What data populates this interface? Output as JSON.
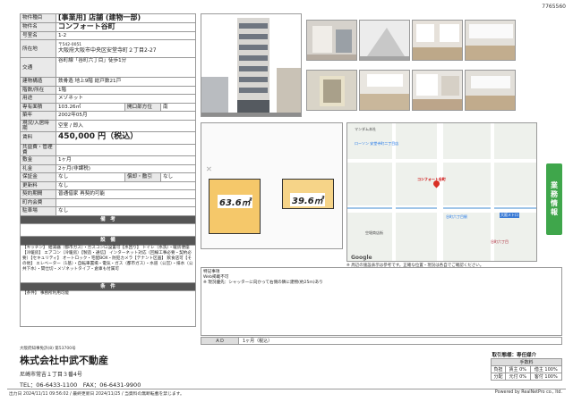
{
  "doc_id": "7765560",
  "property": {
    "type_label": "物件種目",
    "type_value": "[事業用] 店舗 (建物一部)",
    "name_label": "物件名",
    "name_value": "コンフォート谷町",
    "room_label": "号室名",
    "room_value": "1-2",
    "address_label": "所在地",
    "zip": "〒542-0051",
    "address": "大阪府大阪市中央区安堂寺町２丁目2-27",
    "access_label": "交通",
    "access_value": "谷町線「谷町六丁目」徒歩1分",
    "structure_label": "建物構造",
    "structure_value": "鉄骨造 地上9階 総戸数21戸",
    "floor_label": "階数/所在",
    "floor_value": "1階",
    "use_label": "用途",
    "use_value": "メゾネット",
    "area_label": "専有面積",
    "area_value": "103.26㎡",
    "direction_label": "開口部方位",
    "direction_value": "南",
    "built_label": "築年",
    "built_value": "2002年05月",
    "status_label": "現況/入居時期",
    "status_value": "空室 / 即入",
    "rent_label": "賃料",
    "rent_value": "450,000 円（税込）",
    "common_label": "共益費・管理費",
    "common_value": "",
    "deposit_label": "敷金",
    "deposit_value": "1ヶ月",
    "keymoney_label": "礼金",
    "keymoney_value": "2ヶ月(非課税)",
    "hoshoukin_label": "保証金",
    "hoshoukin_value": "なし",
    "shokyaku_label": "償却・敷引",
    "shokyaku_value": "なし",
    "renewal_label": "更新料",
    "renewal_value": "なし",
    "contract_label": "契約期間",
    "contract_value": "普通借家 再契約可能",
    "cond_label": "町内会費",
    "cond_value": "",
    "parking_label": "駐車場",
    "parking_value": "なし",
    "notes_header": "備　考",
    "equip_header": "設　備",
    "equip_text": "【キッチン】 給湯器（都市ガス）・ガスコンロ設置可【水回り】 トイレ（水洗）・暖房便座【冷暖房】 エアコン（冷暖房）【製造・通信】 インターネット対応（回線工事必要・契約必要）【セキュリティ】 オートロック・宅配BOX・防犯カメラ【テナント区画】 飲食店可【その他】 エレベーター（1基）・自転車置場・電気・ガス（都市ガス）・水道（公営）・排水（公共下水）・間仕切・メゾネットタイプ・倉庫も付属可",
    "cond_header": "条　件",
    "cond_text": "【条件】 事務所利用可能"
  },
  "floorplan": {
    "area1": "63.6㎡",
    "area2": "39.6㎡"
  },
  "map": {
    "note": "※ 周辺の施設表示は参考です。正確な位置・現況は各自でご確認ください。",
    "labels": [
      "マンダム本社",
      "ローソン 安堂寺町二丁目店",
      "コンフォート谷町",
      "谷町六丁目駅",
      "空堀商店街",
      "谷町六丁目",
      "Google",
      "大阪メトロ"
    ]
  },
  "remarks": {
    "title": "特記事項",
    "line1": "Web掲載不可",
    "line2": "※ 現況優先：シャッターに向かって右側の隣に建物(約25m)あり",
    "ad_label": "ＡＤ",
    "ad_value": "1ヶ月（税込）"
  },
  "badge": "業務情報",
  "agency": {
    "license": "大阪府知事免許(8) 第53700号",
    "name": "株式会社中武不動産",
    "address": "尼崎市常吉１丁目３番4号",
    "tel": "TEL：06-6433-1100　FAX：06-6431-9900"
  },
  "deal": {
    "header": "取引態様：専任媒介",
    "sub": "手数料",
    "row1_label": "負担",
    "row1_a": "賃主 0%",
    "row1_b": "借主 100%",
    "row2_label": "分配",
    "row2_a": "元付 0%",
    "row2_b": "客付 100%"
  },
  "footer": {
    "left": "出力日 2024/11/11 09:56:02 / 最終更新日 2024/11/25 / 当資料の無断転載を禁じます。",
    "right": "Powered by RealNetPro co., ltd."
  },
  "colors": {
    "badge_green": "#3fa64b",
    "floor_orange": "#f5c86a",
    "header_gray": "#555555"
  }
}
